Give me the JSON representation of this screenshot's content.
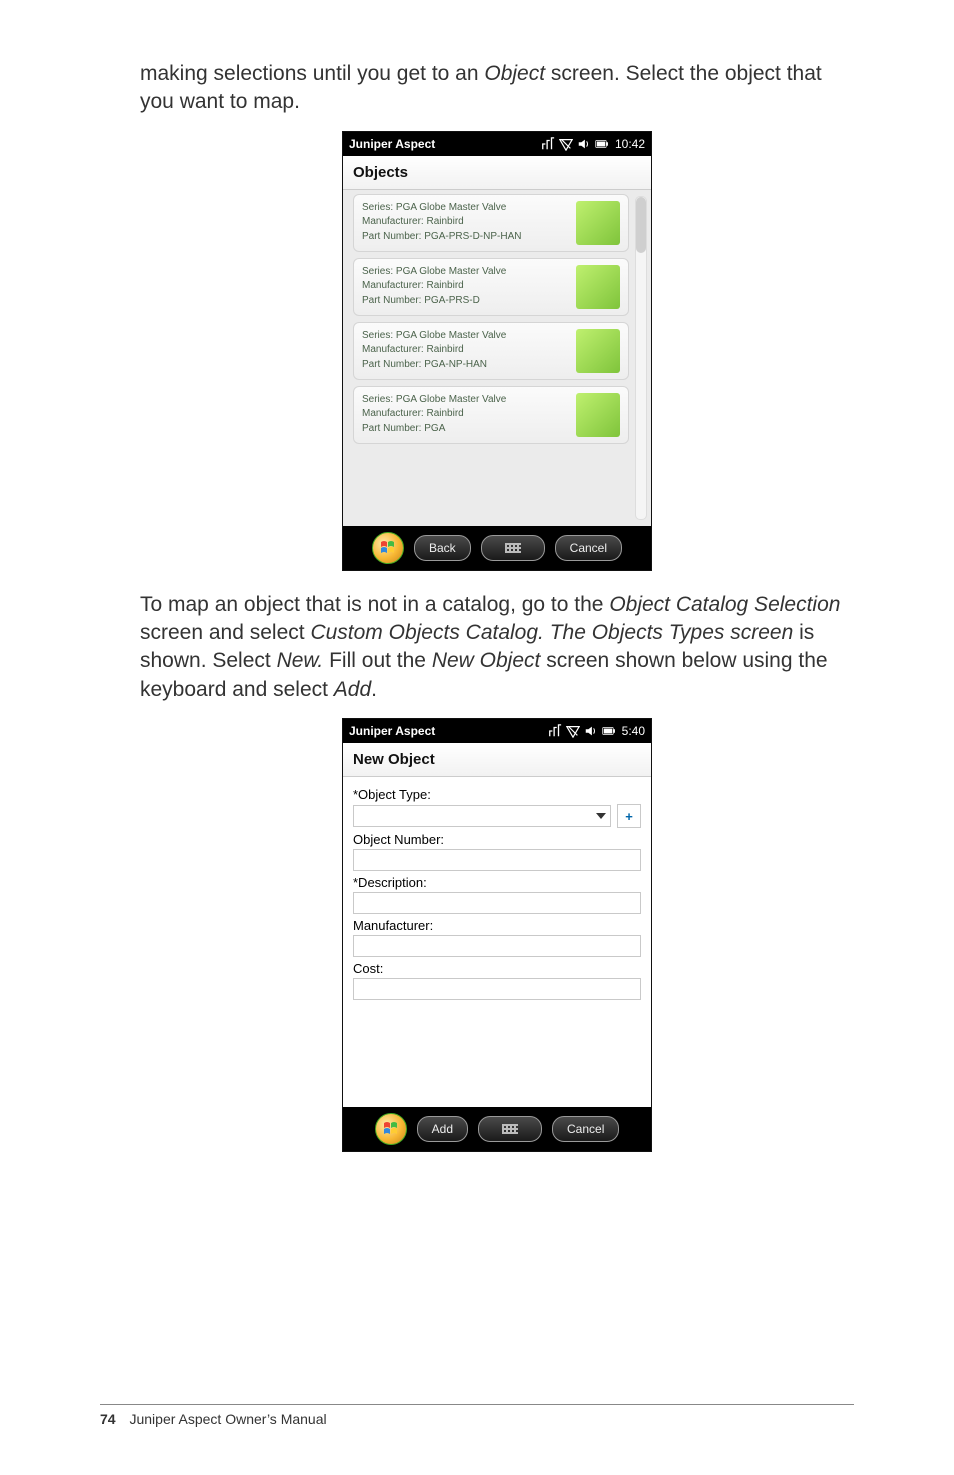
{
  "para1_pre": "making selections until you get to an ",
  "para1_obj": "Object",
  "para1_post": " screen. Select the object that you want to map.",
  "para2_a": "To map an object that is not in a catalog, go to the ",
  "para2_b": "Object Catalog Selection",
  "para2_c": " screen and select ",
  "para2_d": "Custom Objects Catalog. The Objects Types screen",
  "para2_e": " is shown. Select ",
  "para2_f": "New.",
  "para2_g": " Fill out the ",
  "para2_h": "New Object",
  "para2_i": " screen shown below using the keyboard and select ",
  "para2_j": "Add",
  "para2_k": ".",
  "screens": {
    "objects": {
      "app_title": "Juniper Aspect",
      "time": "10:42",
      "page_title": "Objects",
      "items": [
        {
          "l1": "Series: PGA Globe Master Valve",
          "l2": "Manufacturer: Rainbird",
          "l3": "Part Number: PGA-PRS-D-NP-HAN"
        },
        {
          "l1": "Series: PGA Globe Master Valve",
          "l2": "Manufacturer: Rainbird",
          "l3": "Part Number: PGA-PRS-D"
        },
        {
          "l1": "Series: PGA Globe Master Valve",
          "l2": "Manufacturer: Rainbird",
          "l3": "Part Number: PGA-NP-HAN"
        },
        {
          "l1": "Series: PGA Globe Master Valve",
          "l2": "Manufacturer: Rainbird",
          "l3": "Part Number: PGA"
        }
      ],
      "back": "Back",
      "cancel": "Cancel"
    },
    "newobj": {
      "app_title": "Juniper Aspect",
      "time": "5:40",
      "page_title": "New Object",
      "labels": {
        "object_type": "*Object Type:",
        "object_number": "Object Number:",
        "description": "*Description:",
        "manufacturer": "Manufacturer:",
        "cost": "Cost:",
        "plus": "+"
      },
      "add": "Add",
      "cancel": "Cancel"
    }
  },
  "footer": {
    "page": "74",
    "title": "Juniper Aspect Owner’s Manual"
  }
}
